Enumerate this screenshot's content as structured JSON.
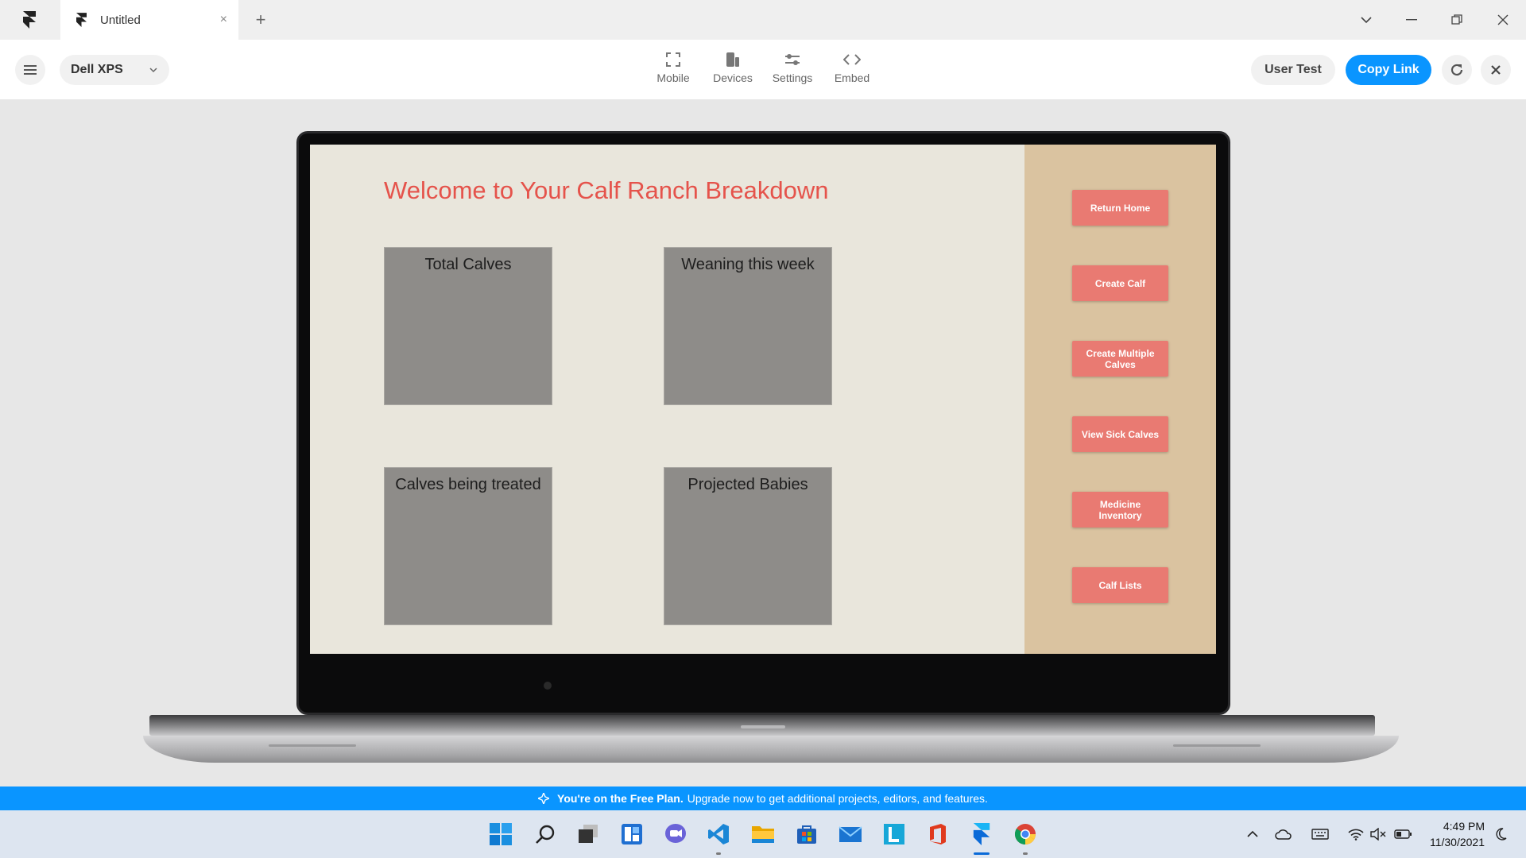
{
  "tab": {
    "title": "Untitled",
    "close_glyph": "×",
    "new_tab_glyph": "+"
  },
  "toolbar": {
    "device": "Dell XPS",
    "tools": [
      {
        "label": "Mobile",
        "icon": "mobile-frame-icon"
      },
      {
        "label": "Devices",
        "icon": "devices-icon"
      },
      {
        "label": "Settings",
        "icon": "settings-sliders-icon"
      },
      {
        "label": "Embed",
        "icon": "embed-code-icon"
      }
    ],
    "user_test": "User Test",
    "copy_link": "Copy Link"
  },
  "screen": {
    "title": "Welcome to Your Calf Ranch Breakdown",
    "cards": [
      {
        "label": "Total Calves"
      },
      {
        "label": "Weaning this week"
      },
      {
        "label": "Calves being treated"
      },
      {
        "label": "Projected Babies"
      }
    ],
    "nav": [
      {
        "label": "Return Home"
      },
      {
        "label": "Create Calf"
      },
      {
        "label": "Create Multiple Calves"
      },
      {
        "label": "View Sick Calves"
      },
      {
        "label": "Medicine Inventory"
      },
      {
        "label": "Calf Lists"
      }
    ]
  },
  "banner": {
    "strong": "You're on the Free Plan.",
    "text": "Upgrade now to get additional projects, editors, and features."
  },
  "taskbar": {
    "apps": [
      "windows-start-icon",
      "search-icon",
      "task-view-icon",
      "widgets-icon",
      "chat-icon",
      "vscode-icon",
      "file-explorer-icon",
      "microsoft-store-icon",
      "mail-icon",
      "l-app-icon",
      "office-icon",
      "framer-icon",
      "chrome-icon"
    ],
    "time": "4:49 PM",
    "date": "11/30/2021"
  },
  "colors": {
    "accent": "#0a95ff",
    "screen_title": "#e5534b",
    "screen_bg": "#e9e6dc",
    "side_panel": "#dac3a0",
    "side_button": "#e97a72",
    "card": "#8e8c89"
  }
}
